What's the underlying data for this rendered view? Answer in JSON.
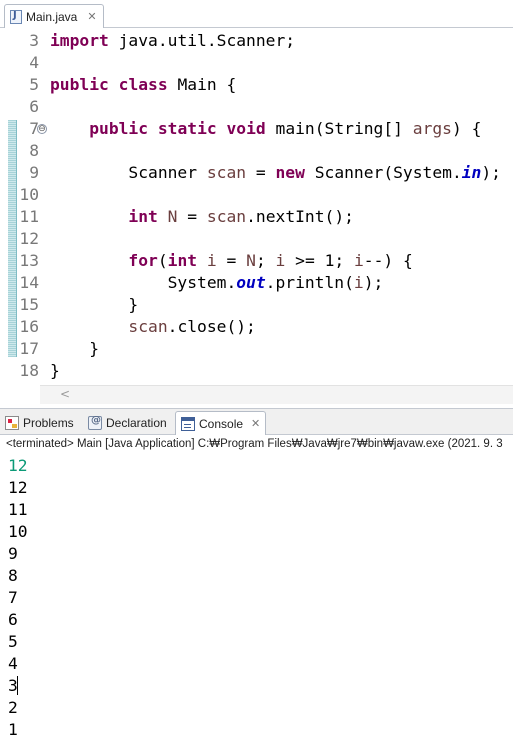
{
  "editor": {
    "tab_label": "Main.java",
    "close_glyph": "✕",
    "lines": [
      {
        "n": "3",
        "tokens": [
          {
            "t": "import",
            "c": "kw"
          },
          {
            "t": " java.util.Scanner;"
          }
        ]
      },
      {
        "n": "4",
        "tokens": []
      },
      {
        "n": "5",
        "tokens": [
          {
            "t": "public",
            "c": "kw"
          },
          {
            "t": " "
          },
          {
            "t": "class",
            "c": "kw"
          },
          {
            "t": " Main {"
          }
        ]
      },
      {
        "n": "6",
        "tokens": []
      },
      {
        "n": "7",
        "fold": "⊖",
        "tokens": [
          {
            "t": "    "
          },
          {
            "t": "public",
            "c": "kw"
          },
          {
            "t": " "
          },
          {
            "t": "static",
            "c": "kw"
          },
          {
            "t": " "
          },
          {
            "t": "void",
            "c": "kw"
          },
          {
            "t": " main(String[] "
          },
          {
            "t": "args",
            "c": "var"
          },
          {
            "t": ") {"
          }
        ]
      },
      {
        "n": "8",
        "tokens": []
      },
      {
        "n": "9",
        "tokens": [
          {
            "t": "        Scanner "
          },
          {
            "t": "scan",
            "c": "var"
          },
          {
            "t": " = "
          },
          {
            "t": "new",
            "c": "kw"
          },
          {
            "t": " Scanner(System."
          },
          {
            "t": "in",
            "c": "fld"
          },
          {
            "t": ");"
          }
        ]
      },
      {
        "n": "10",
        "tokens": []
      },
      {
        "n": "11",
        "tokens": [
          {
            "t": "        "
          },
          {
            "t": "int",
            "c": "kw"
          },
          {
            "t": " "
          },
          {
            "t": "N",
            "c": "var"
          },
          {
            "t": " = "
          },
          {
            "t": "scan",
            "c": "var"
          },
          {
            "t": ".nextInt();"
          }
        ]
      },
      {
        "n": "12",
        "tokens": []
      },
      {
        "n": "13",
        "tokens": [
          {
            "t": "        "
          },
          {
            "t": "for",
            "c": "kw"
          },
          {
            "t": "("
          },
          {
            "t": "int",
            "c": "kw"
          },
          {
            "t": " "
          },
          {
            "t": "i",
            "c": "var"
          },
          {
            "t": " = "
          },
          {
            "t": "N",
            "c": "var"
          },
          {
            "t": "; "
          },
          {
            "t": "i",
            "c": "var"
          },
          {
            "t": " >= 1; "
          },
          {
            "t": "i",
            "c": "var"
          },
          {
            "t": "--) {"
          }
        ]
      },
      {
        "n": "14",
        "tokens": [
          {
            "t": "            System."
          },
          {
            "t": "out",
            "c": "fld"
          },
          {
            "t": ".println("
          },
          {
            "t": "i",
            "c": "var"
          },
          {
            "t": ");"
          }
        ]
      },
      {
        "n": "15",
        "tokens": [
          {
            "t": "        }"
          }
        ]
      },
      {
        "n": "16",
        "tokens": [
          {
            "t": "        "
          },
          {
            "t": "scan",
            "c": "var"
          },
          {
            "t": ".close();"
          }
        ]
      },
      {
        "n": "17",
        "tokens": [
          {
            "t": "    }"
          }
        ]
      },
      {
        "n": "18",
        "tokens": [
          {
            "t": "}"
          }
        ]
      }
    ],
    "scroll_left_glyph": "<"
  },
  "console": {
    "tabs": [
      {
        "label": "Problems",
        "icon": "problems-icon",
        "active": false
      },
      {
        "label": "Declaration",
        "icon": "declaration-icon",
        "active": false
      },
      {
        "label": "Console",
        "icon": "console-icon",
        "active": true
      }
    ],
    "close_glyph": "✕",
    "status": "<terminated> Main [Java Application] C:₩Program Files₩Java₩jre7₩bin₩javaw.exe (2021. 9. 3",
    "input_line": "12",
    "output_lines": [
      "12",
      "11",
      "10",
      "9",
      "8",
      "7",
      "6",
      "5",
      "4",
      "3",
      "2",
      "1"
    ]
  },
  "colors": {
    "keyword": "#7f0055",
    "local_variable": "#6a3e3e",
    "static_field": "#0000c0",
    "console_input": "#0c9a77",
    "line_number": "#787878"
  }
}
